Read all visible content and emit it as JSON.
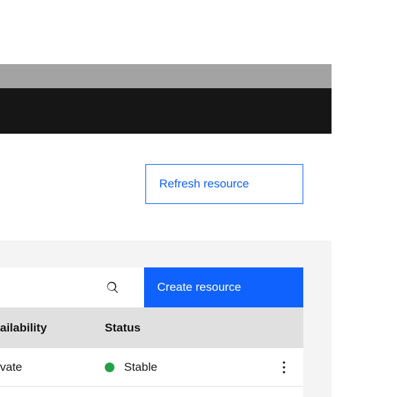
{
  "actions": {
    "refresh": "Refresh resource",
    "create": "Create resource"
  },
  "table": {
    "columns": [
      "ailability",
      "Status"
    ],
    "rows": [
      {
        "availability": "vate",
        "status": "Stable"
      }
    ]
  },
  "colors": {
    "primary": "#0f62fe",
    "success": "#24a148",
    "headerBg": "#161616",
    "tableHeader": "#e0e0e0",
    "band": "#f4f4f4"
  }
}
